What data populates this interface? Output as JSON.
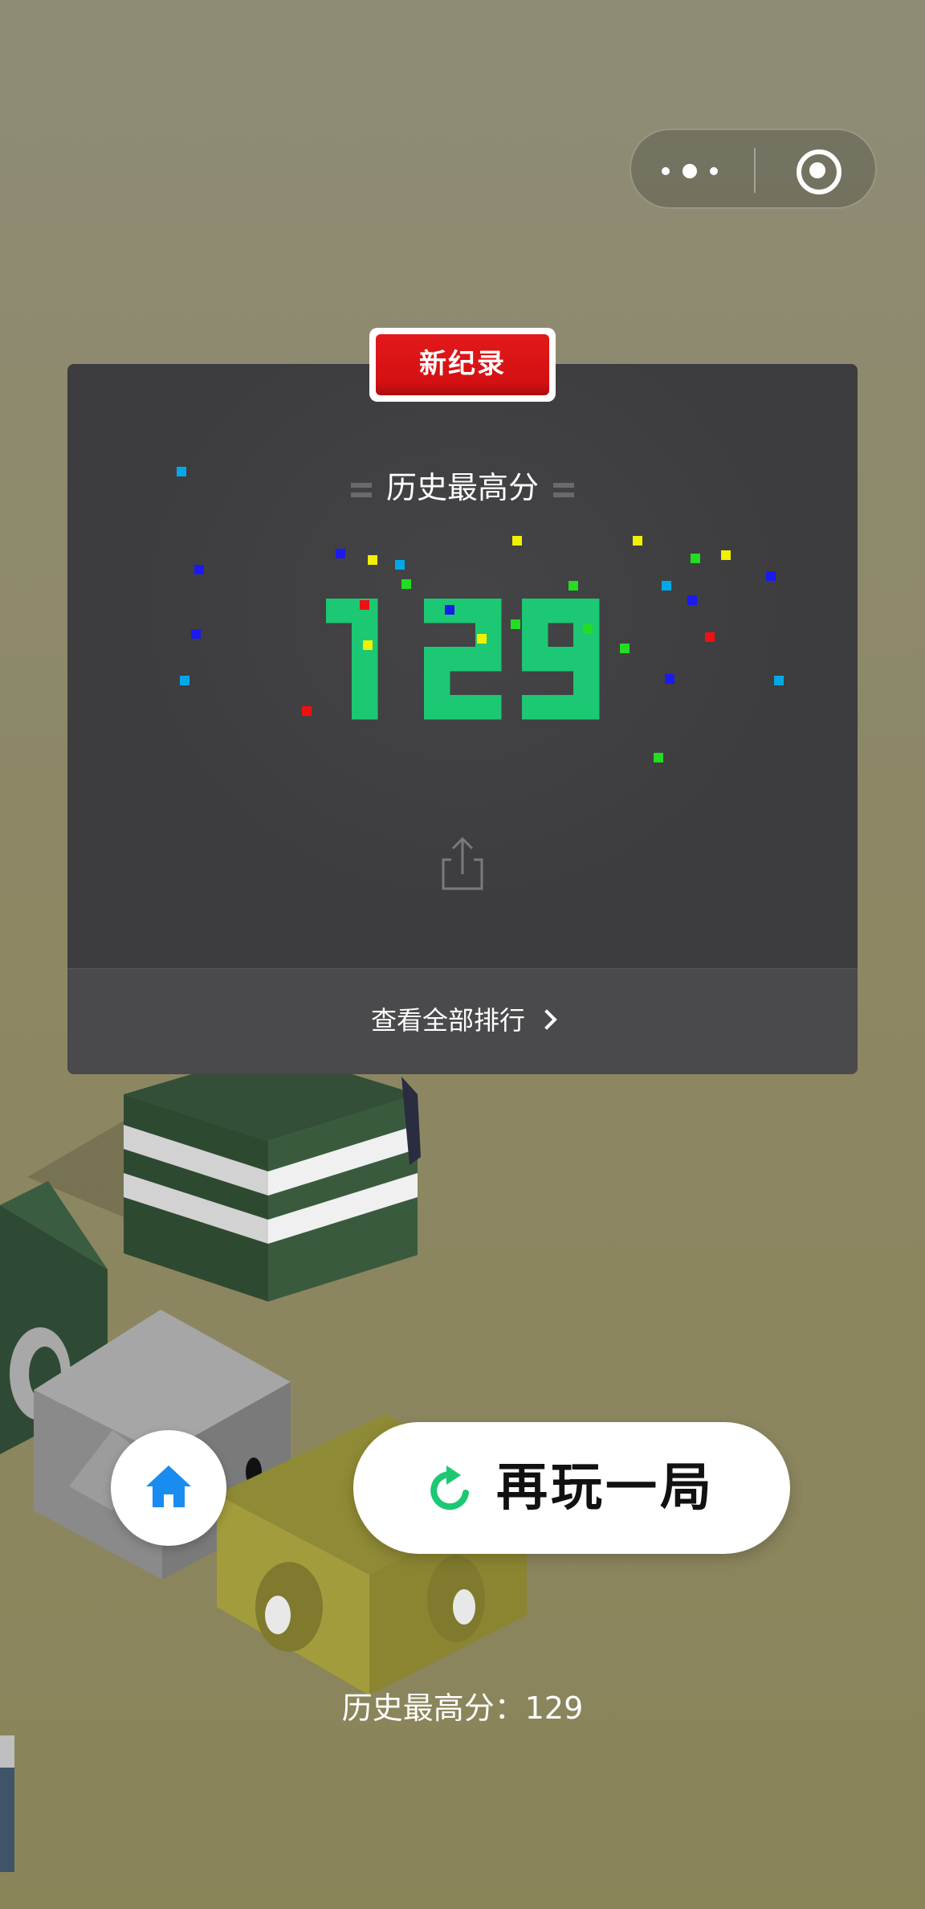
{
  "capsule": {
    "more_icon": "more-dots-icon",
    "close_icon": "close-target-icon"
  },
  "record_badge": "新纪录",
  "high_score_title": "历史最高分",
  "score": "129",
  "score_color": "#1cc873",
  "share_icon": "share-icon",
  "ranking_link": "查看全部排行",
  "home_icon": "home-icon",
  "home_color": "#1a8cf0",
  "replay_label": "再玩一局",
  "replay_icon": "replay-icon",
  "replay_icon_color": "#1cc873",
  "best_label": "历史最高分：",
  "best_value": "129",
  "confetti_colors": [
    "#00a8e8",
    "#1a1aef",
    "#f0f000",
    "#ee1111",
    "#22dd22"
  ]
}
